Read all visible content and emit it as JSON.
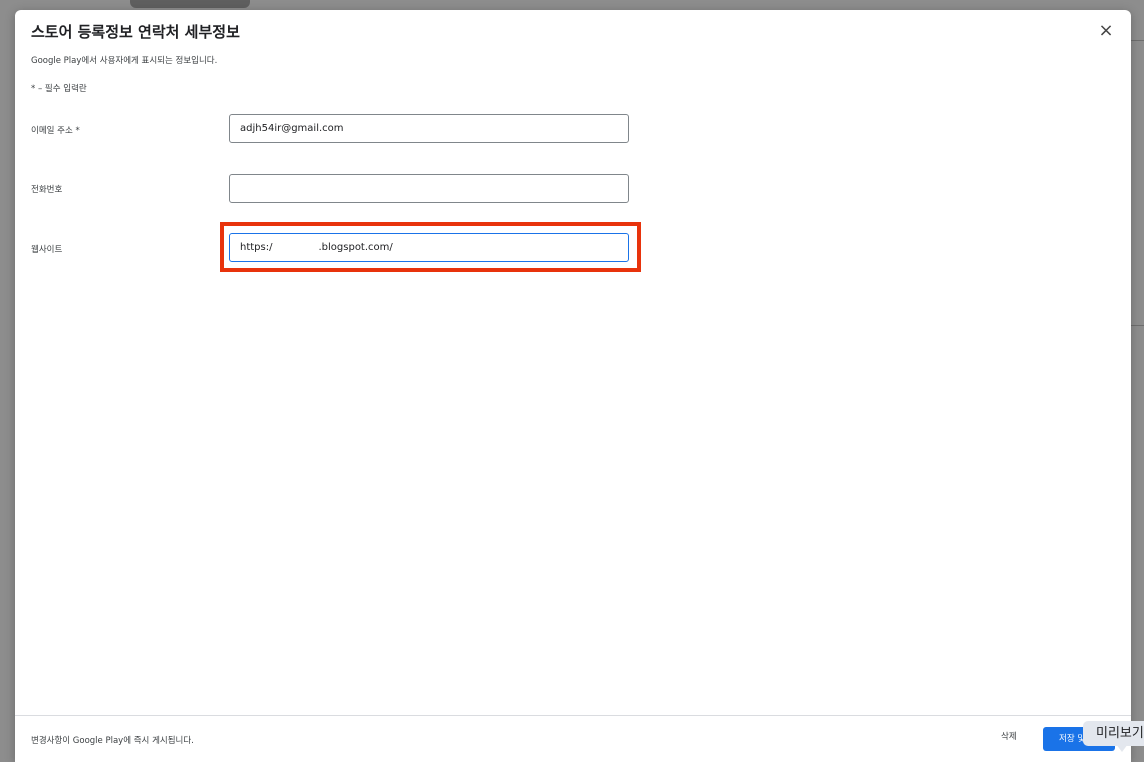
{
  "dialog": {
    "title": "스토어 등록정보 연락처 세부정보",
    "close_icon": "×",
    "subtitle": "Google Play에서 사용자에게 표시되는 정보입니다.",
    "required_note": "* – 필수 입력란"
  },
  "fields": {
    "email": {
      "label": "이메일 주소  *",
      "value": "adjh54ir@gmail.com"
    },
    "phone": {
      "label": "전화번호",
      "value": ""
    },
    "website": {
      "label": "웹사이트",
      "value_start": "https:/",
      "value_end": ".blogspot.com/"
    }
  },
  "footer": {
    "text": "변경사항이 Google Play에 즉시 게시됩니다.",
    "delete_label": "삭제",
    "save_label": "저장 및"
  },
  "tooltip": {
    "preview_label": "미리보기"
  },
  "colors": {
    "accent": "#1a73e8",
    "highlight": "#e8330c"
  }
}
